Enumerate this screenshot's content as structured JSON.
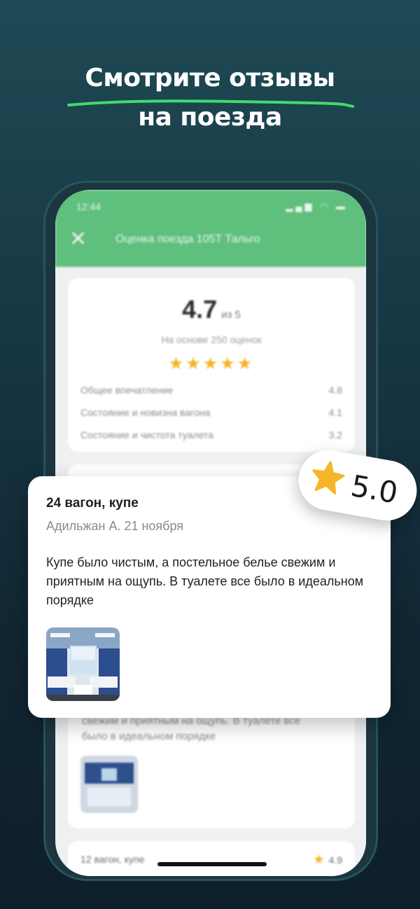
{
  "promo": {
    "headline_line1": "Смотрите отзывы",
    "headline_line2": "на поезда",
    "underline_color": "#3fdc6a"
  },
  "phone": {
    "status_time": "12:44",
    "status_icons": "signal-wifi-battery",
    "nav_title": "Оценка поезда 105Т Тальго",
    "close_icon": "close-icon",
    "rating": {
      "value": "4.7",
      "out_of": "из 5",
      "based_on": "На основе 250 оценок",
      "stars": "★★★★★",
      "criteria": [
        {
          "label": "Общее впечатление",
          "value": "4.8"
        },
        {
          "label": "Состояние и новизна вагона",
          "value": "4.1"
        },
        {
          "label": "Состояние и чистота туалета",
          "value": "3.2"
        }
      ]
    },
    "bg_review_text_line1": "свежим и приятным на ощупь. В туалете все",
    "bg_review_text_line2": "было в идеальном порядке",
    "next_review": {
      "title": "12 вагон, купе",
      "score": "4.9"
    }
  },
  "review": {
    "title": "24 вагон, купе",
    "meta": "Адильжан А. 21 ноября",
    "body": "Купе было чистым, а постельное белье свежим и приятным на ощупь. В туалете все было в идеальном порядке",
    "photo": "train-compartment-photo"
  },
  "badge": {
    "value": "5.0",
    "star_color": "#f5b728"
  },
  "colors": {
    "accent_green": "#5fbf7d",
    "star": "#f2b321",
    "background": "#173844"
  }
}
